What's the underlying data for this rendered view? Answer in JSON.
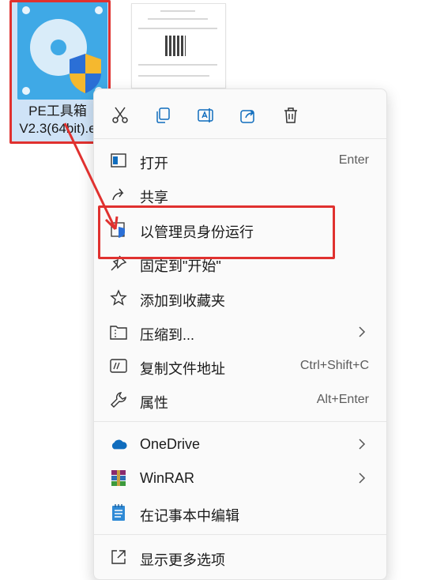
{
  "file": {
    "name_line1": "PE工具箱",
    "name_line2": "V2.3(64bit).e"
  },
  "toolbar": {
    "cut_icon": "scissors-icon",
    "copy_icon": "copy-icon",
    "rename_icon": "rename-icon",
    "share_icon": "share-icon",
    "delete_icon": "trash-icon"
  },
  "menu": {
    "open": {
      "label": "打开",
      "shortcut": "Enter"
    },
    "share": {
      "label": "共享"
    },
    "run_as_admin": {
      "label": "以管理员身份运行"
    },
    "pin_start": {
      "label": "固定到\"开始\""
    },
    "add_favorites": {
      "label": "添加到收藏夹"
    },
    "compress": {
      "label": "压缩到..."
    },
    "copy_path": {
      "label": "复制文件地址",
      "shortcut": "Ctrl+Shift+C"
    },
    "properties": {
      "label": "属性",
      "shortcut": "Alt+Enter"
    },
    "onedrive": {
      "label": "OneDrive"
    },
    "winrar": {
      "label": "WinRAR"
    },
    "notepad": {
      "label": "在记事本中编辑"
    },
    "more_options": {
      "label": "显示更多选项"
    }
  },
  "colors": {
    "annotation_red": "#e0312f",
    "accent_blue": "#3fa9e6"
  }
}
